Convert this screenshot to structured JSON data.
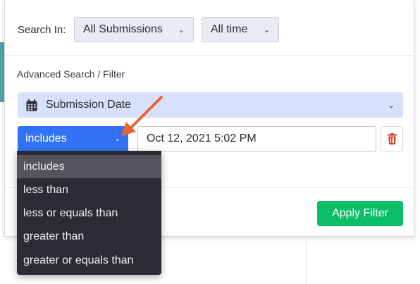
{
  "header": {
    "search_in_label": "Search In:",
    "scope_select": "All Submissions",
    "time_select": "All time"
  },
  "advanced": {
    "title": "Advanced Search / Filter",
    "field_select": "Submission Date",
    "operator_select": "includes",
    "value_input": "Oct 12, 2021 5:02 PM"
  },
  "operator_menu": {
    "items": [
      "includes",
      "less than",
      "less or equals than",
      "greater than",
      "greater or equals than"
    ],
    "selected": "includes"
  },
  "footer": {
    "apply_label": "Apply Filter"
  },
  "colors": {
    "operator_bg": "#3273f5",
    "field_bg": "#d8e1fb",
    "apply_bg": "#0abf68",
    "menu_bg": "#2b2c33",
    "menu_active_bg": "#53545c",
    "delete_icon": "#d93025",
    "annotation_arrow": "#e8663a"
  },
  "icons": {
    "field": "calendar-icon",
    "delete": "trash-icon",
    "dropdown": "chevron-down-icon"
  }
}
